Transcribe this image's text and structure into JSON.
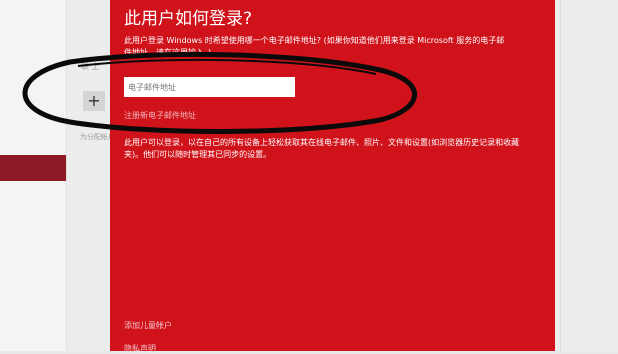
{
  "background": {
    "snippet_top": "联 上",
    "snippet_hint": "为分配帐户"
  },
  "dialog": {
    "title": "此用户如何登录?",
    "intro": "此用户登录 Windows 时希望使用哪一个电子邮件地址? (如果你知道他们用来登录 Microsoft 服务的电子邮件地址，请在这里输入。)",
    "email_placeholder": "电子邮件地址",
    "signup_link": "注册新电子邮件地址",
    "description": "此用户可以登录，以在自己的所有设备上轻松获取其在线电子邮件、照片、文件和设置(如浏览器历史记录和收藏夹)。他们可以随时管理其已同步的设置。",
    "child_link": "添加儿童帐户",
    "privacy_link": "隐私声明"
  },
  "colors": {
    "dialog_bg": "#d0121b",
    "sidebar_selected": "#8d1b25"
  },
  "icons": {
    "add": "+"
  }
}
